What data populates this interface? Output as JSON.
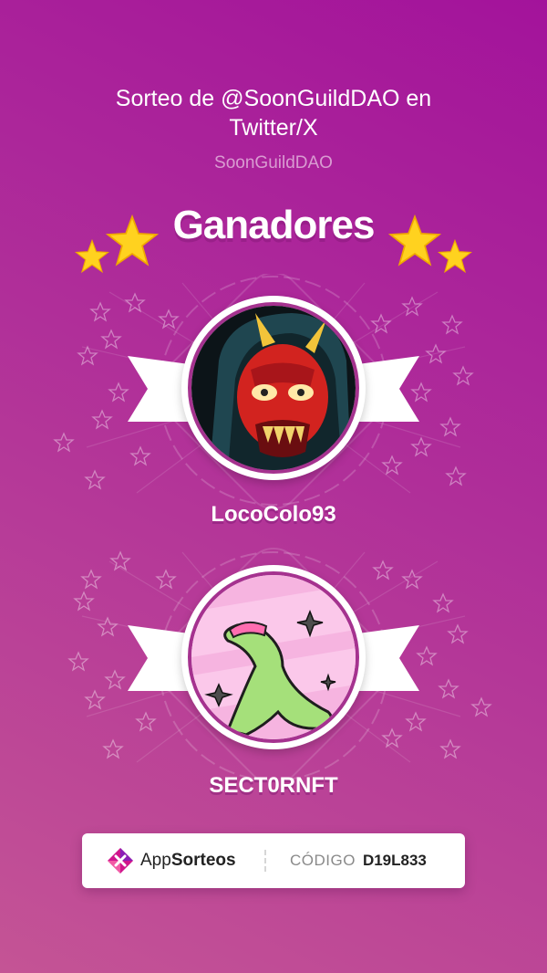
{
  "header": {
    "title": "Sorteo de @SoonGuildDAO en Twitter/X",
    "subtitle": "SoonGuildDAO"
  },
  "heading": {
    "label": "Ganadores",
    "icons": [
      "star-icon",
      "star-icon",
      "star-icon",
      "star-icon"
    ]
  },
  "winners": [
    {
      "name": "LocoColo93",
      "avatar": "red-oni-mask-avatar"
    },
    {
      "name": "SECT0RNFT",
      "avatar": "green-dino-shuriken-avatar"
    }
  ],
  "footer": {
    "brand_prefix": "App",
    "brand_suffix": "Sorteos",
    "code_label": "CÓDIGO",
    "code_value": "D19L833"
  },
  "colors": {
    "bg_top": "#a3139b",
    "bg_bottom": "#c45495",
    "ring": "#a5328f",
    "star": "#ffd21f"
  }
}
